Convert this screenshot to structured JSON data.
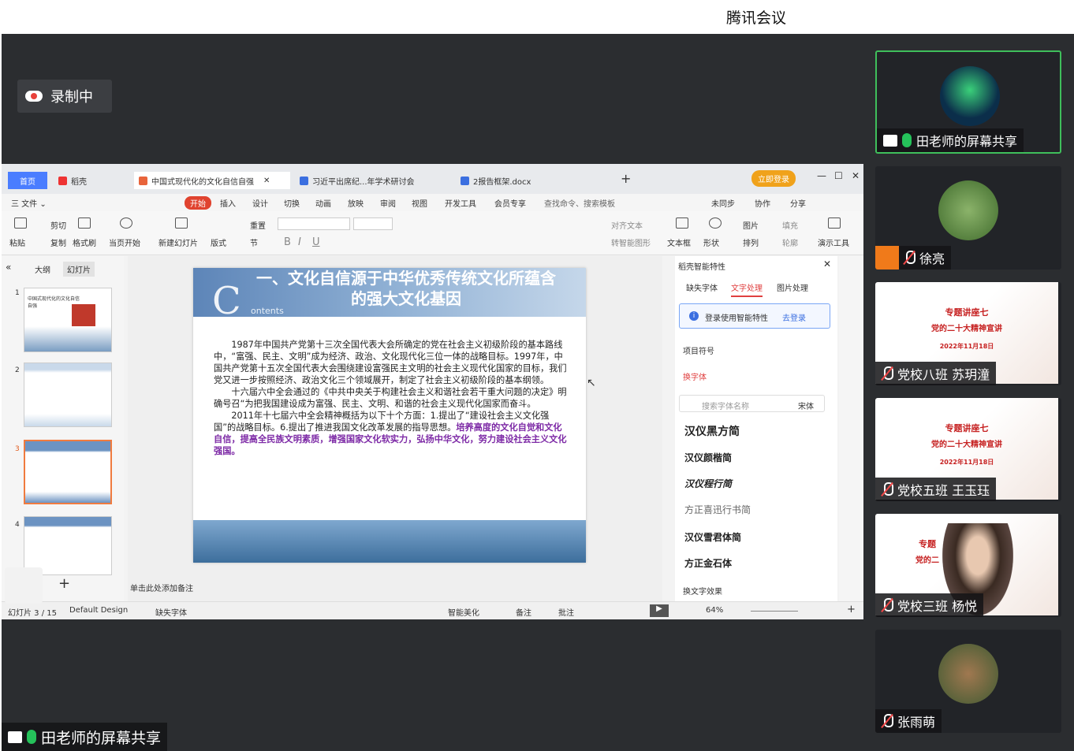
{
  "app": {
    "title": "腾讯会议",
    "recording": "录制中",
    "share_label": "田老师的屏幕共享"
  },
  "wps": {
    "tabs": [
      "首页",
      "稻壳",
      "中国式现代化的文化自信自强",
      "习近平出席纪...年学术研讨会",
      "2报告框架.docx"
    ],
    "login": "立即登录",
    "menu": [
      "三 文件 ⌄",
      "开始",
      "插入",
      "设计",
      "切换",
      "动画",
      "放映",
      "审阅",
      "视图",
      "开发工具",
      "会员专享",
      "查找命令、搜索模板",
      "未同步",
      "协作",
      "分享"
    ],
    "ribbon": {
      "paste": "粘贴",
      "cut": "剪切",
      "copy": "复制",
      "format": "格式刷",
      "play": "当页开始",
      "new_slide": "新建幻灯片",
      "layout": "版式",
      "reset": "重置",
      "section": "节",
      "align_text": "对齐文本",
      "smartart": "转智能图形",
      "textbox": "文本框",
      "shape": "形状",
      "picture": "图片",
      "arrange": "排列",
      "fill": "填充",
      "outline": "轮廓",
      "present": "演示工具"
    },
    "left": {
      "outline": "大纲",
      "slides": "幻灯片",
      "slide1": "中国式现代化的文化自信自强",
      "add_notes": "单击此处添加备注"
    },
    "slide": {
      "title": "一、文化自信源于中华优秀传统文化所蕴含的强大文化基因",
      "big_c": "C",
      "contents": "ontents",
      "p1": "1987年中国共产党第十三次全国代表大会所确定的党在社会主义初级阶段的基本路线中，“富强、民主、文明”成为经济、政治、文化现代化三位一体的战略目标。1997年，中国共产党第十五次全国代表大会围绕建设富强民主文明的社会主义现代化国家的目标，我们党又进一步按照经济、政治文化三个领域展开，制定了社会主义初级阶段的基本纲领。",
      "p2": "十六届六中全会通过的《中共中央关于构建社会主义和谐社会若干重大问题的决定》明确号召“为把我国建设成为富强、民主、文明、和谐的社会主义现代化国家而奋斗。",
      "p3a": "2011年十七届六中全会精神概括为以下十个方面：1.提出了“建设社会主义文化强国”的战略目标。6.提出了推进我国文化改革发展的指导思想。",
      "p3b": "培养高度的文化自觉和文化自信，提高全民族文明素质，增强国家文化软实力，弘扬中华文化，努力建设社会主义文化强国。"
    },
    "right": {
      "header": "稻壳智能特性",
      "tabs": [
        "缺失字体",
        "文字处理",
        "图片处理"
      ],
      "login_prompt": "登录使用智能特性",
      "login_link": "去登录",
      "item_symbol": "项目符号",
      "replace_font": "换字体",
      "search_placeholder": "搜索字体名称",
      "font_default": "宋体",
      "fonts": [
        "汉仪黑方简",
        "汉仪颜楷简",
        "汉仪程行简",
        "方正喜迅行书简",
        "汉仪雪君体简",
        "方正金石体"
      ],
      "text_effect": "换文字效果"
    },
    "status": {
      "page": "幻灯片 3 / 15",
      "design": "Default Design",
      "missing": "缺失字体",
      "beautify": "智能美化",
      "notes": "备注",
      "comment": "批注",
      "zoom": "64%"
    }
  },
  "participants": [
    {
      "name": "田老师的屏幕共享",
      "screen": true,
      "mic": "on"
    },
    {
      "name": "徐亮",
      "mic": "off"
    },
    {
      "name": "党校八班 苏玥潼",
      "mic": "off",
      "poster": true
    },
    {
      "name": "党校五班 王玉珏",
      "mic": "off",
      "poster": true
    },
    {
      "name": "党校三班 杨悦",
      "mic": "off",
      "poster": true
    },
    {
      "name": "张雨萌",
      "mic": "off"
    }
  ],
  "poster": {
    "l1": "专题讲座七",
    "l2": "党的二十大精神宣讲",
    "l3": "2022年11月18日",
    "l1_partial": "专题",
    "l2_partial": "党的二"
  }
}
